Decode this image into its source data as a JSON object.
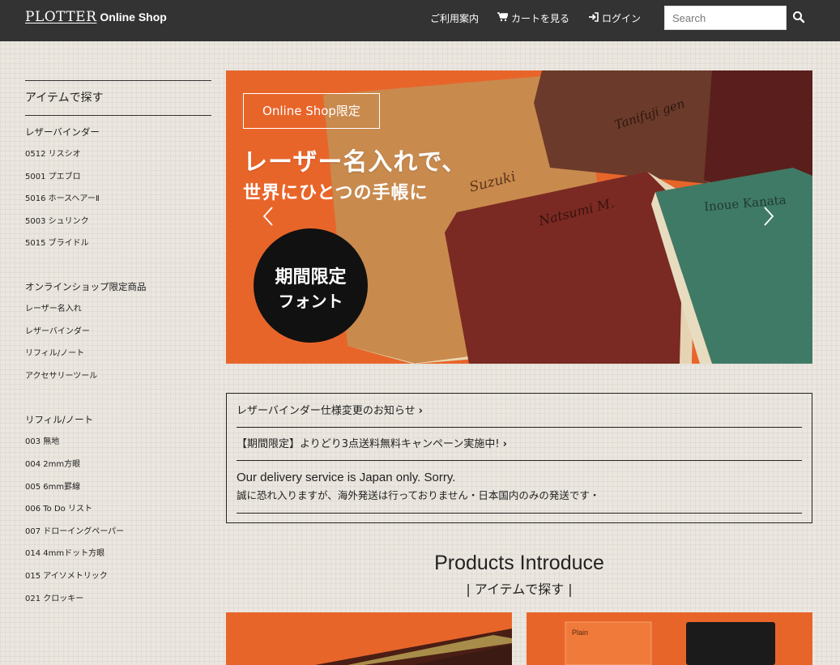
{
  "header": {
    "logo_main": "PLOTTER",
    "logo_sub": "Online Shop",
    "nav": {
      "guide": "ご利用案内",
      "cart": "カートを見る",
      "login": "ログイン"
    },
    "search_placeholder": "Search",
    "icons": [
      "cart-icon",
      "login-icon",
      "search-icon"
    ]
  },
  "sidebar": {
    "title": "アイテムで探す",
    "groups": [
      {
        "heading": "レザーバインダー",
        "items": [
          "0512 リスシオ",
          "5001 プエブロ",
          "5016 ホースヘアーⅡ",
          "5003 シュリンク",
          "5015 ブライドル"
        ]
      },
      {
        "heading": "オンラインショップ限定商品",
        "items": [
          "レーザー名入れ",
          "レザーバインダー",
          "リフィル/ノート",
          "アクセサリーツール"
        ]
      },
      {
        "heading": "リフィル/ノート",
        "items": [
          "003 無地",
          "004 2mm方眼",
          "005 6mm罫線",
          "006 To Do リスト",
          "007 ドローイングペーパー",
          "014 4mmドット方眼",
          "015 アイソメトリック",
          "021 クロッキー"
        ]
      }
    ]
  },
  "carousel": {
    "badge": "Online Shop限定",
    "headline1": "レーザー名入れで、",
    "headline2": "世界にひとつの手帳に",
    "circle_line1": "期間限定",
    "circle_line2": "フォント",
    "engravings": [
      "Suzuki",
      "Tanifuji gen",
      "Natsumi M.",
      "Inoue Kanata"
    ],
    "colors": {
      "background": "#e8652a",
      "tan": "#c98a4e",
      "brown": "#6b3a2a",
      "burgundy": "#7a2a22",
      "green": "#3f7a66"
    }
  },
  "notice": {
    "link1": "レザーバインダー仕様変更のお知らせ",
    "link2": "【期間限定】よりどり3点送料無料キャンペーン実施中!",
    "info_en": "Our delivery service is Japan only. Sorry.",
    "info_jp": "誠に恐れ入りますが、海外発送は行っておりません・日本国内のみの発送です・"
  },
  "products": {
    "title": "Products Introduce",
    "subtitle": "| アイテムで探す |",
    "card2_label": "Plain"
  },
  "colors": {
    "header_bg": "#333333",
    "accent_orange": "#e8652a",
    "page_bg": "#ebe7e0"
  }
}
